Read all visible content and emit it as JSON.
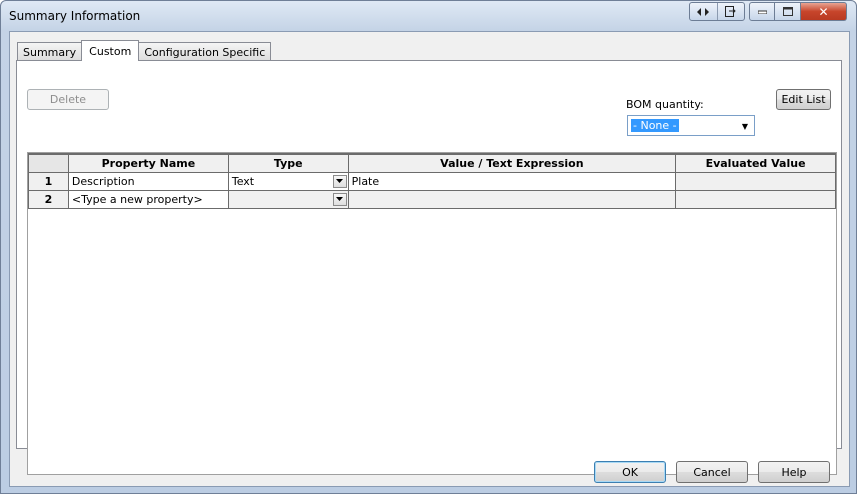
{
  "window": {
    "title": "Summary Information",
    "extra_buttons": [
      "left-right-arrows-icon",
      "export-icon"
    ],
    "min_glyph": "▭",
    "max_glyph": "□",
    "close_glyph": "✕"
  },
  "tabs": [
    {
      "label": "Summary",
      "active": false
    },
    {
      "label": "Custom",
      "active": true
    },
    {
      "label": "Configuration Specific",
      "active": false
    }
  ],
  "toolbar": {
    "delete_label": "Delete",
    "edit_list_label": "Edit List"
  },
  "bom": {
    "label": "BOM quantity:",
    "selected": "- None -"
  },
  "grid": {
    "columns": [
      "Property Name",
      "Type",
      "Value / Text Expression",
      "Evaluated Value"
    ],
    "rows": [
      {
        "num": "1",
        "name": "Description",
        "type": "Text",
        "value": "Plate",
        "evaluated": ""
      },
      {
        "num": "2",
        "name": "<Type a new property>",
        "type": "",
        "value": "",
        "evaluated": ""
      }
    ]
  },
  "footer": {
    "ok_label": "OK",
    "cancel_label": "Cancel",
    "help_label": "Help"
  }
}
